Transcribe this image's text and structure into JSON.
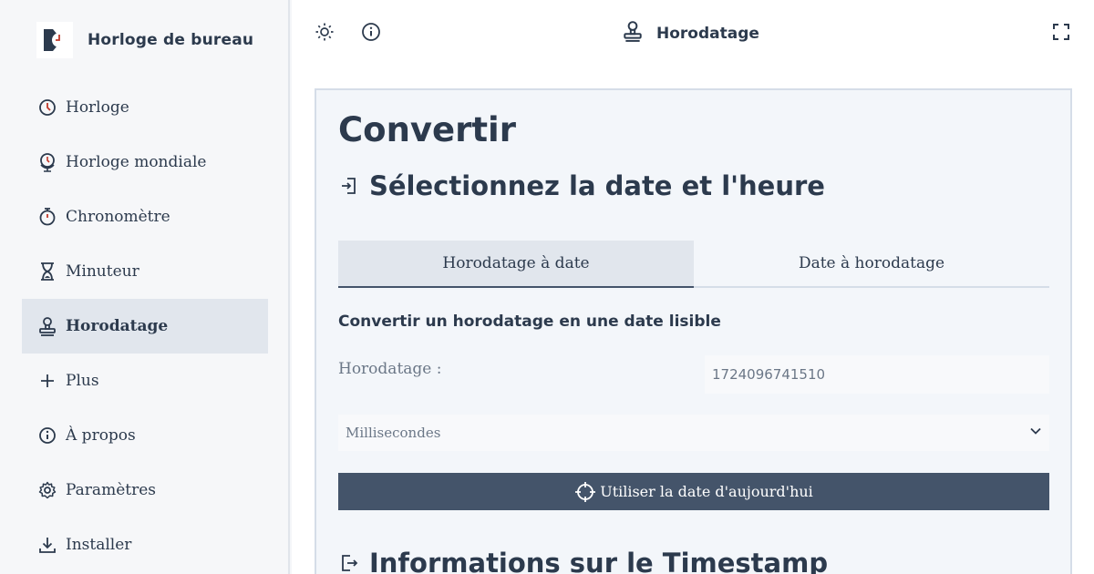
{
  "app": {
    "name": "Horloge de bureau"
  },
  "sidebar": {
    "items": [
      {
        "label": "Horloge",
        "icon": "clock-icon",
        "active": false
      },
      {
        "label": "Horloge mondiale",
        "icon": "globe-clock-icon",
        "active": false
      },
      {
        "label": "Chronomètre",
        "icon": "stopwatch-icon",
        "active": false
      },
      {
        "label": "Minuteur",
        "icon": "hourglass-icon",
        "active": false
      },
      {
        "label": "Horodatage",
        "icon": "stamp-icon",
        "active": true
      },
      {
        "label": "Plus",
        "icon": "plus-icon",
        "active": false
      },
      {
        "label": "À propos",
        "icon": "info-icon",
        "active": false
      },
      {
        "label": "Paramètres",
        "icon": "gear-icon",
        "active": false
      },
      {
        "label": "Installer",
        "icon": "download-icon",
        "active": false
      }
    ]
  },
  "topbar": {
    "title": "Horodatage"
  },
  "main": {
    "heading": "Convertir",
    "section_title": "Sélectionnez la date et l'heure",
    "tabs": [
      {
        "label": "Horodatage à date",
        "active": true
      },
      {
        "label": "Date à horodatage",
        "active": false
      }
    ],
    "subtitle": "Convertir un horodatage en une date lisible",
    "timestamp_label": "Horodatage :",
    "timestamp_value": "1724096741510",
    "unit_select": "Millisecondes",
    "use_today_button": "Utiliser la date d'aujourd'hui",
    "info_title": "Informations sur le Timestamp"
  },
  "colors": {
    "accent": "#44546a",
    "text": "#2c3a4d",
    "active_bg": "#e1e6ed",
    "logo_red": "#c0392b"
  }
}
